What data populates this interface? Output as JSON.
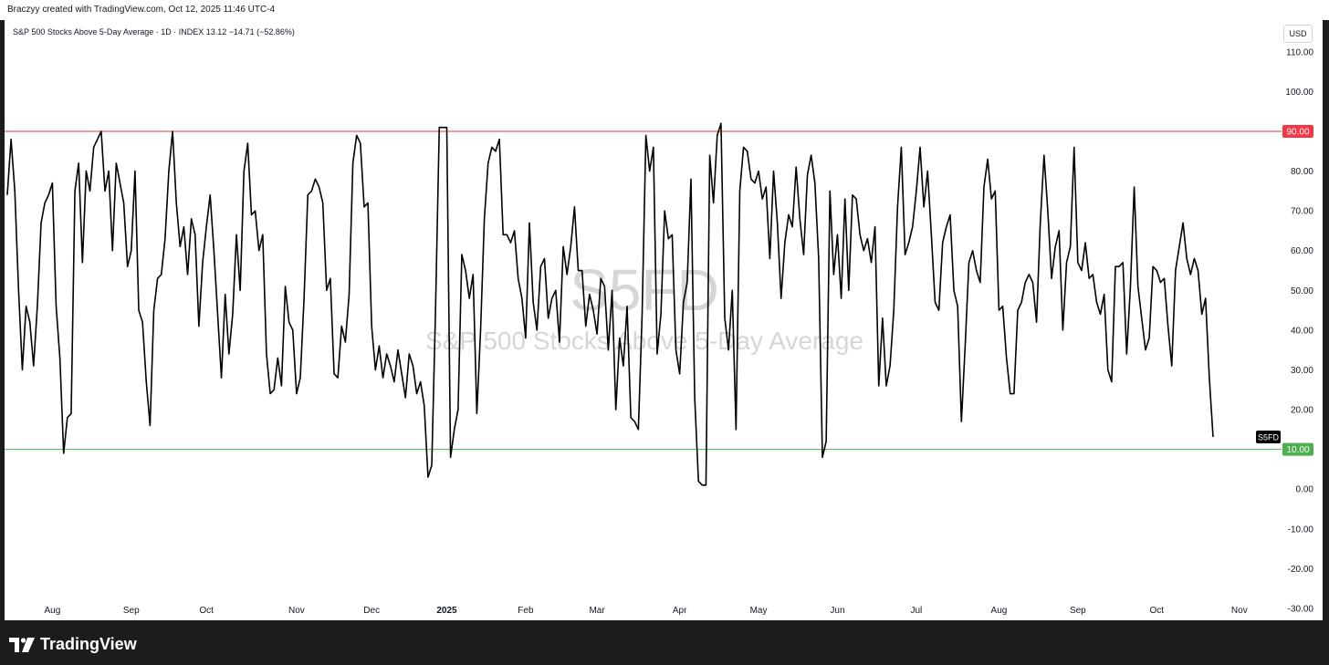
{
  "header": {
    "credit": "Braczyy created with TradingView.com, Oct 12, 2025 11:46 UTC-4",
    "legend": "S&P 500 Stocks Above 5-Day Average · 1D · INDEX  13.12  −14.71 (−52.86%)",
    "currency": "USD"
  },
  "watermark": {
    "symbol": "S5FD",
    "name": "S&P 500 Stocks Above 5-Day Average"
  },
  "footer": {
    "brand": "TradingView"
  },
  "chart_data": {
    "type": "line",
    "ylim": [
      -33,
      118
    ],
    "yticks": [
      "110.00",
      "100.00",
      "90.00",
      "80.00",
      "70.00",
      "60.00",
      "50.00",
      "40.00",
      "30.00",
      "20.00",
      "10.00",
      "0.00",
      "-10.00",
      "-20.00",
      "-30.00"
    ],
    "xticks": [
      {
        "label": "Aug",
        "index": 12
      },
      {
        "label": "Sep",
        "index": 33
      },
      {
        "label": "Oct",
        "index": 53
      },
      {
        "label": "Nov",
        "index": 77
      },
      {
        "label": "Dec",
        "index": 97
      },
      {
        "label": "2025",
        "index": 117
      },
      {
        "label": "Feb",
        "index": 138
      },
      {
        "label": "Mar",
        "index": 157
      },
      {
        "label": "Apr",
        "index": 179
      },
      {
        "label": "May",
        "index": 200
      },
      {
        "label": "Jun",
        "index": 221
      },
      {
        "label": "Jul",
        "index": 242
      },
      {
        "label": "Aug",
        "index": 264
      },
      {
        "label": "Sep",
        "index": 285
      },
      {
        "label": "Oct",
        "index": 306
      },
      {
        "label": "Nov",
        "index": 328
      }
    ],
    "hlines": [
      {
        "value": 90,
        "label": "90.00",
        "color": "#f23645"
      },
      {
        "value": 10,
        "label": "10.00",
        "color": "#4caf50"
      }
    ],
    "last_marker": {
      "label": "S5FD",
      "value": 13.12
    },
    "series": [
      {
        "color": "#000000",
        "values": [
          74,
          88,
          75,
          50,
          30,
          46,
          42,
          31,
          46,
          67,
          72,
          74,
          77,
          46,
          33,
          9,
          18,
          19,
          75,
          82,
          57,
          80,
          75,
          86,
          88,
          90,
          75,
          80,
          60,
          82,
          77,
          72,
          56,
          60,
          80,
          45,
          42,
          27,
          16,
          45,
          53,
          54,
          63,
          80,
          90,
          72,
          61,
          66,
          54,
          68,
          64,
          41,
          57,
          66,
          74,
          60,
          44,
          28,
          49,
          34,
          44,
          64,
          50,
          80,
          87,
          69,
          70,
          60,
          64,
          34,
          24,
          25,
          33,
          26,
          51,
          42,
          40,
          24,
          28,
          48,
          74,
          75,
          78,
          76,
          72,
          50,
          53,
          29,
          28,
          41,
          37,
          49,
          82,
          89,
          87,
          71,
          72,
          41,
          30,
          36,
          28,
          34,
          31,
          27,
          35,
          29,
          23,
          34,
          31,
          24,
          27,
          21,
          3,
          6,
          45,
          91,
          91,
          91,
          8,
          15,
          20,
          59,
          55,
          48,
          54,
          19,
          40,
          68,
          82,
          86,
          85,
          88,
          64,
          64,
          62,
          65,
          53,
          48,
          38,
          67,
          47,
          40,
          56,
          58,
          43,
          48,
          50,
          37,
          61,
          54,
          61,
          71,
          55,
          55,
          41,
          49,
          45,
          39,
          53,
          51,
          35,
          50,
          20,
          38,
          31,
          46,
          18,
          17,
          15,
          44,
          89,
          80,
          86,
          34,
          44,
          70,
          63,
          64,
          35,
          29,
          47,
          52,
          78,
          23,
          2,
          1,
          1,
          84,
          72,
          89,
          92,
          43,
          35,
          50,
          15,
          75,
          86,
          85,
          78,
          77,
          80,
          73,
          76,
          58,
          80,
          67,
          48,
          62,
          69,
          66,
          81,
          68,
          59,
          79,
          84,
          77,
          58,
          8,
          12,
          75,
          54,
          64,
          48,
          73,
          50,
          74,
          73,
          64,
          60,
          63,
          57,
          66,
          26,
          43,
          26,
          31,
          45,
          71,
          86,
          59,
          62,
          66,
          75,
          86,
          71,
          80,
          64,
          47,
          45,
          62,
          66,
          69,
          50,
          46,
          17,
          36,
          57,
          60,
          55,
          52,
          76,
          83,
          73,
          75,
          45,
          46,
          33,
          24,
          24,
          45,
          47,
          52,
          54,
          52,
          42,
          67,
          84,
          70,
          53,
          61,
          65,
          40,
          57,
          61,
          86,
          57,
          55,
          62,
          53,
          54,
          47,
          44,
          49,
          30,
          27,
          56,
          56,
          57,
          34,
          51,
          76,
          51,
          43,
          35,
          38,
          56,
          55,
          52,
          53,
          41,
          31,
          55,
          61,
          67,
          58,
          54,
          58,
          55,
          44,
          48,
          28,
          13.12
        ]
      }
    ]
  }
}
